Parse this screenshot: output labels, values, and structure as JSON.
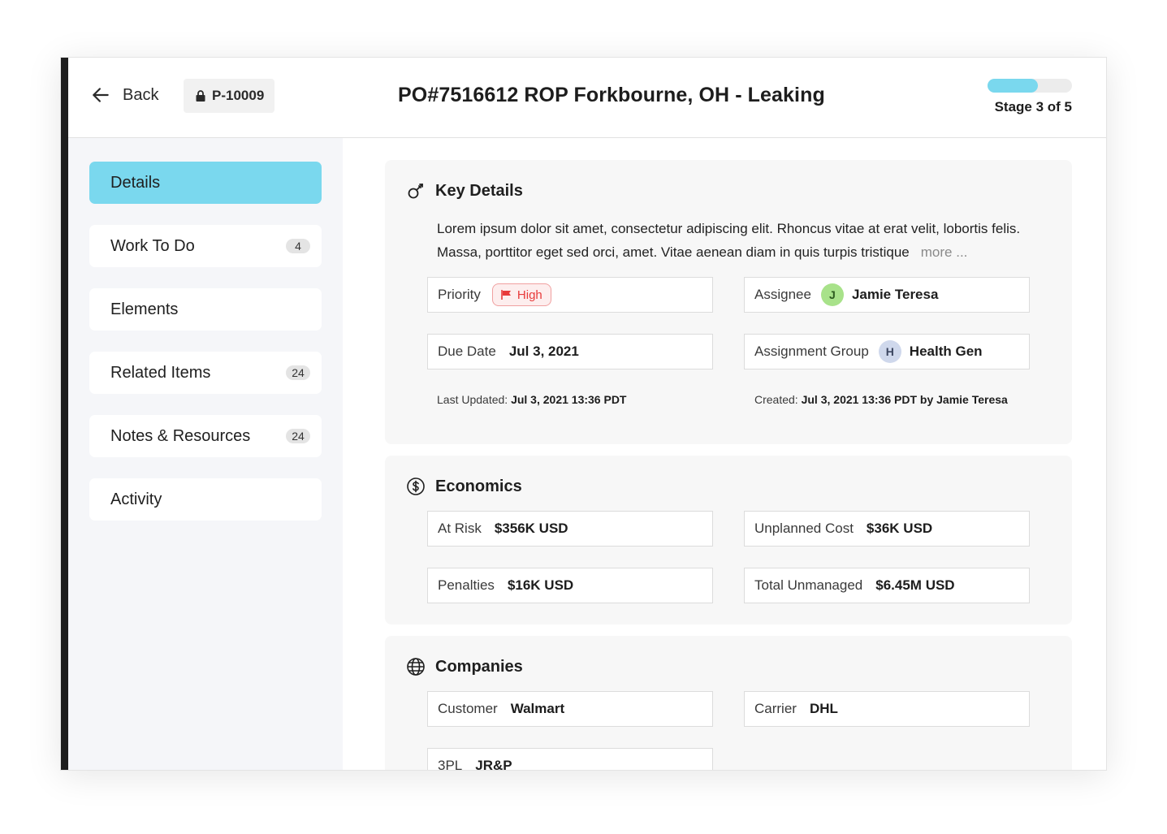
{
  "header": {
    "back_label": "Back",
    "record_id": "P-10009",
    "title": "PO#7516612 ROP Forkbourne, OH - Leaking",
    "stage_label": "Stage 3 of 5",
    "stage_progress": 0.6
  },
  "sidebar": {
    "items": [
      {
        "label": "Details",
        "badge": ""
      },
      {
        "label": "Work To Do",
        "badge": "4"
      },
      {
        "label": "Elements",
        "badge": ""
      },
      {
        "label": "Related Items",
        "badge": "24"
      },
      {
        "label": "Notes & Resources",
        "badge": "24"
      },
      {
        "label": "Activity",
        "badge": ""
      }
    ]
  },
  "key_details": {
    "heading": "Key Details",
    "description": "Lorem ipsum dolor sit amet, consectetur adipiscing elit. Rhoncus vitae at erat velit, lobortis felis. Massa, porttitor eget sed orci, amet. Vitae aenean diam in quis turpis tristique",
    "more_label": "more ...",
    "priority_label": "Priority",
    "priority_value": "High",
    "assignee_label": "Assignee",
    "assignee_initial": "J",
    "assignee_value": "Jamie Teresa",
    "due_label": "Due Date",
    "due_value": "Jul 3, 2021",
    "group_label": "Assignment Group",
    "group_initial": "H",
    "group_value": "Health Gen",
    "last_updated_label": "Last Updated:",
    "last_updated_value": "Jul 3, 2021 13:36 PDT",
    "created_label": "Created:",
    "created_value": "Jul 3, 2021 13:36 PDT by Jamie Teresa"
  },
  "economics": {
    "heading": "Economics",
    "at_risk_label": "At Risk",
    "at_risk_value": "$356K USD",
    "unplanned_label": "Unplanned Cost",
    "unplanned_value": "$36K USD",
    "penalties_label": "Penalties",
    "penalties_value": "$16K USD",
    "total_label": "Total Unmanaged",
    "total_value": "$6.45M USD"
  },
  "companies": {
    "heading": "Companies",
    "customer_label": "Customer",
    "customer_value": "Walmart",
    "carrier_label": "Carrier",
    "carrier_value": "DHL",
    "tpl_label": "3PL",
    "tpl_value": "JR&P"
  },
  "colors": {
    "accent": "#7ad8ee",
    "priority_high": "#e83a3a",
    "assignee_avatar": "#a8e28a",
    "group_avatar": "#cfd8ec"
  }
}
